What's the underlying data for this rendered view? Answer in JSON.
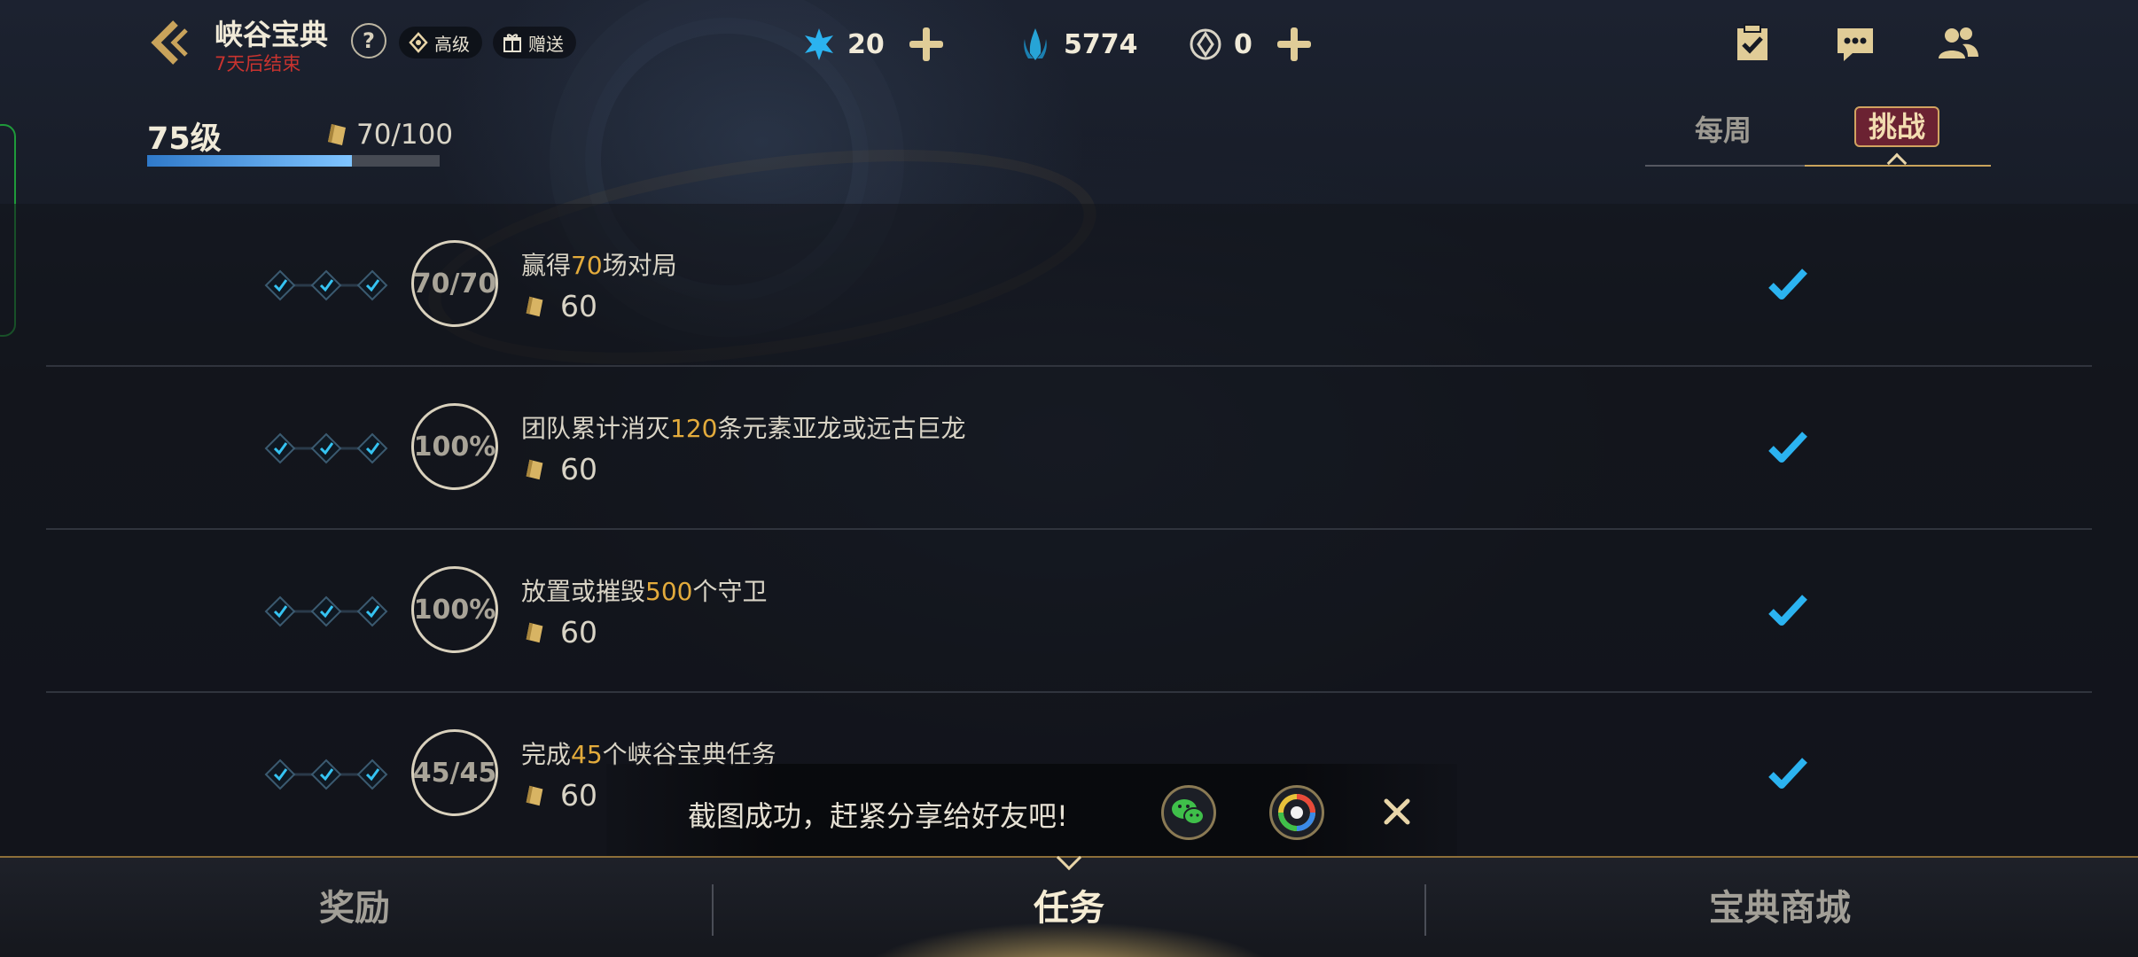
{
  "header": {
    "title": "峡谷宝典",
    "subtitle": "7天后结束",
    "help": "?",
    "badges": [
      {
        "label": "高级",
        "icon": "diamond-icon"
      },
      {
        "label": "赠送",
        "icon": "gift-icon"
      }
    ]
  },
  "currencies": [
    {
      "icon": "blue-star-icon",
      "value": "20",
      "has_add": true
    },
    {
      "icon": "crystal-icon",
      "value": "5774",
      "has_add": false
    },
    {
      "icon": "coin-icon",
      "value": "0",
      "has_add": true
    }
  ],
  "top_icons": [
    "tasks-icon",
    "chat-icon",
    "friends-icon"
  ],
  "level": {
    "label": "75级",
    "points": "70/100",
    "progress": 0.7
  },
  "tabs": {
    "weekly": "每周",
    "challenge": "挑战",
    "active": "challenge"
  },
  "tasks": [
    {
      "title_pre": "赢得",
      "title_hl": "70",
      "title_post": "场对局",
      "progress": "70/70",
      "reward": "60",
      "done": true
    },
    {
      "title_pre": "团队累计消灭",
      "title_hl": "120",
      "title_post": "条元素亚龙或远古巨龙",
      "progress": "100%",
      "reward": "60",
      "done": true
    },
    {
      "title_pre": "放置或摧毁",
      "title_hl": "500",
      "title_post": "个守卫",
      "progress": "100%",
      "reward": "60",
      "done": true
    },
    {
      "title_pre": "完成",
      "title_hl": "45",
      "title_post": "个峡谷宝典任务",
      "progress": "45/45",
      "reward": "60",
      "done": true
    }
  ],
  "toast": {
    "text": "截图成功，赶紧分享给好友吧!",
    "buttons": [
      "wechat-icon",
      "moments-icon",
      "close-icon"
    ]
  },
  "bottom_nav": {
    "rewards": "奖励",
    "tasks": "任务",
    "shop": "宝典商城",
    "active": "tasks"
  },
  "colors": {
    "accent_gold": "#c9a35b",
    "highlight_orange": "#e3ab3c",
    "check_blue": "#2bb3f0",
    "subtitle_red": "#c8332f",
    "progress_blue": "#4a9ee8"
  }
}
